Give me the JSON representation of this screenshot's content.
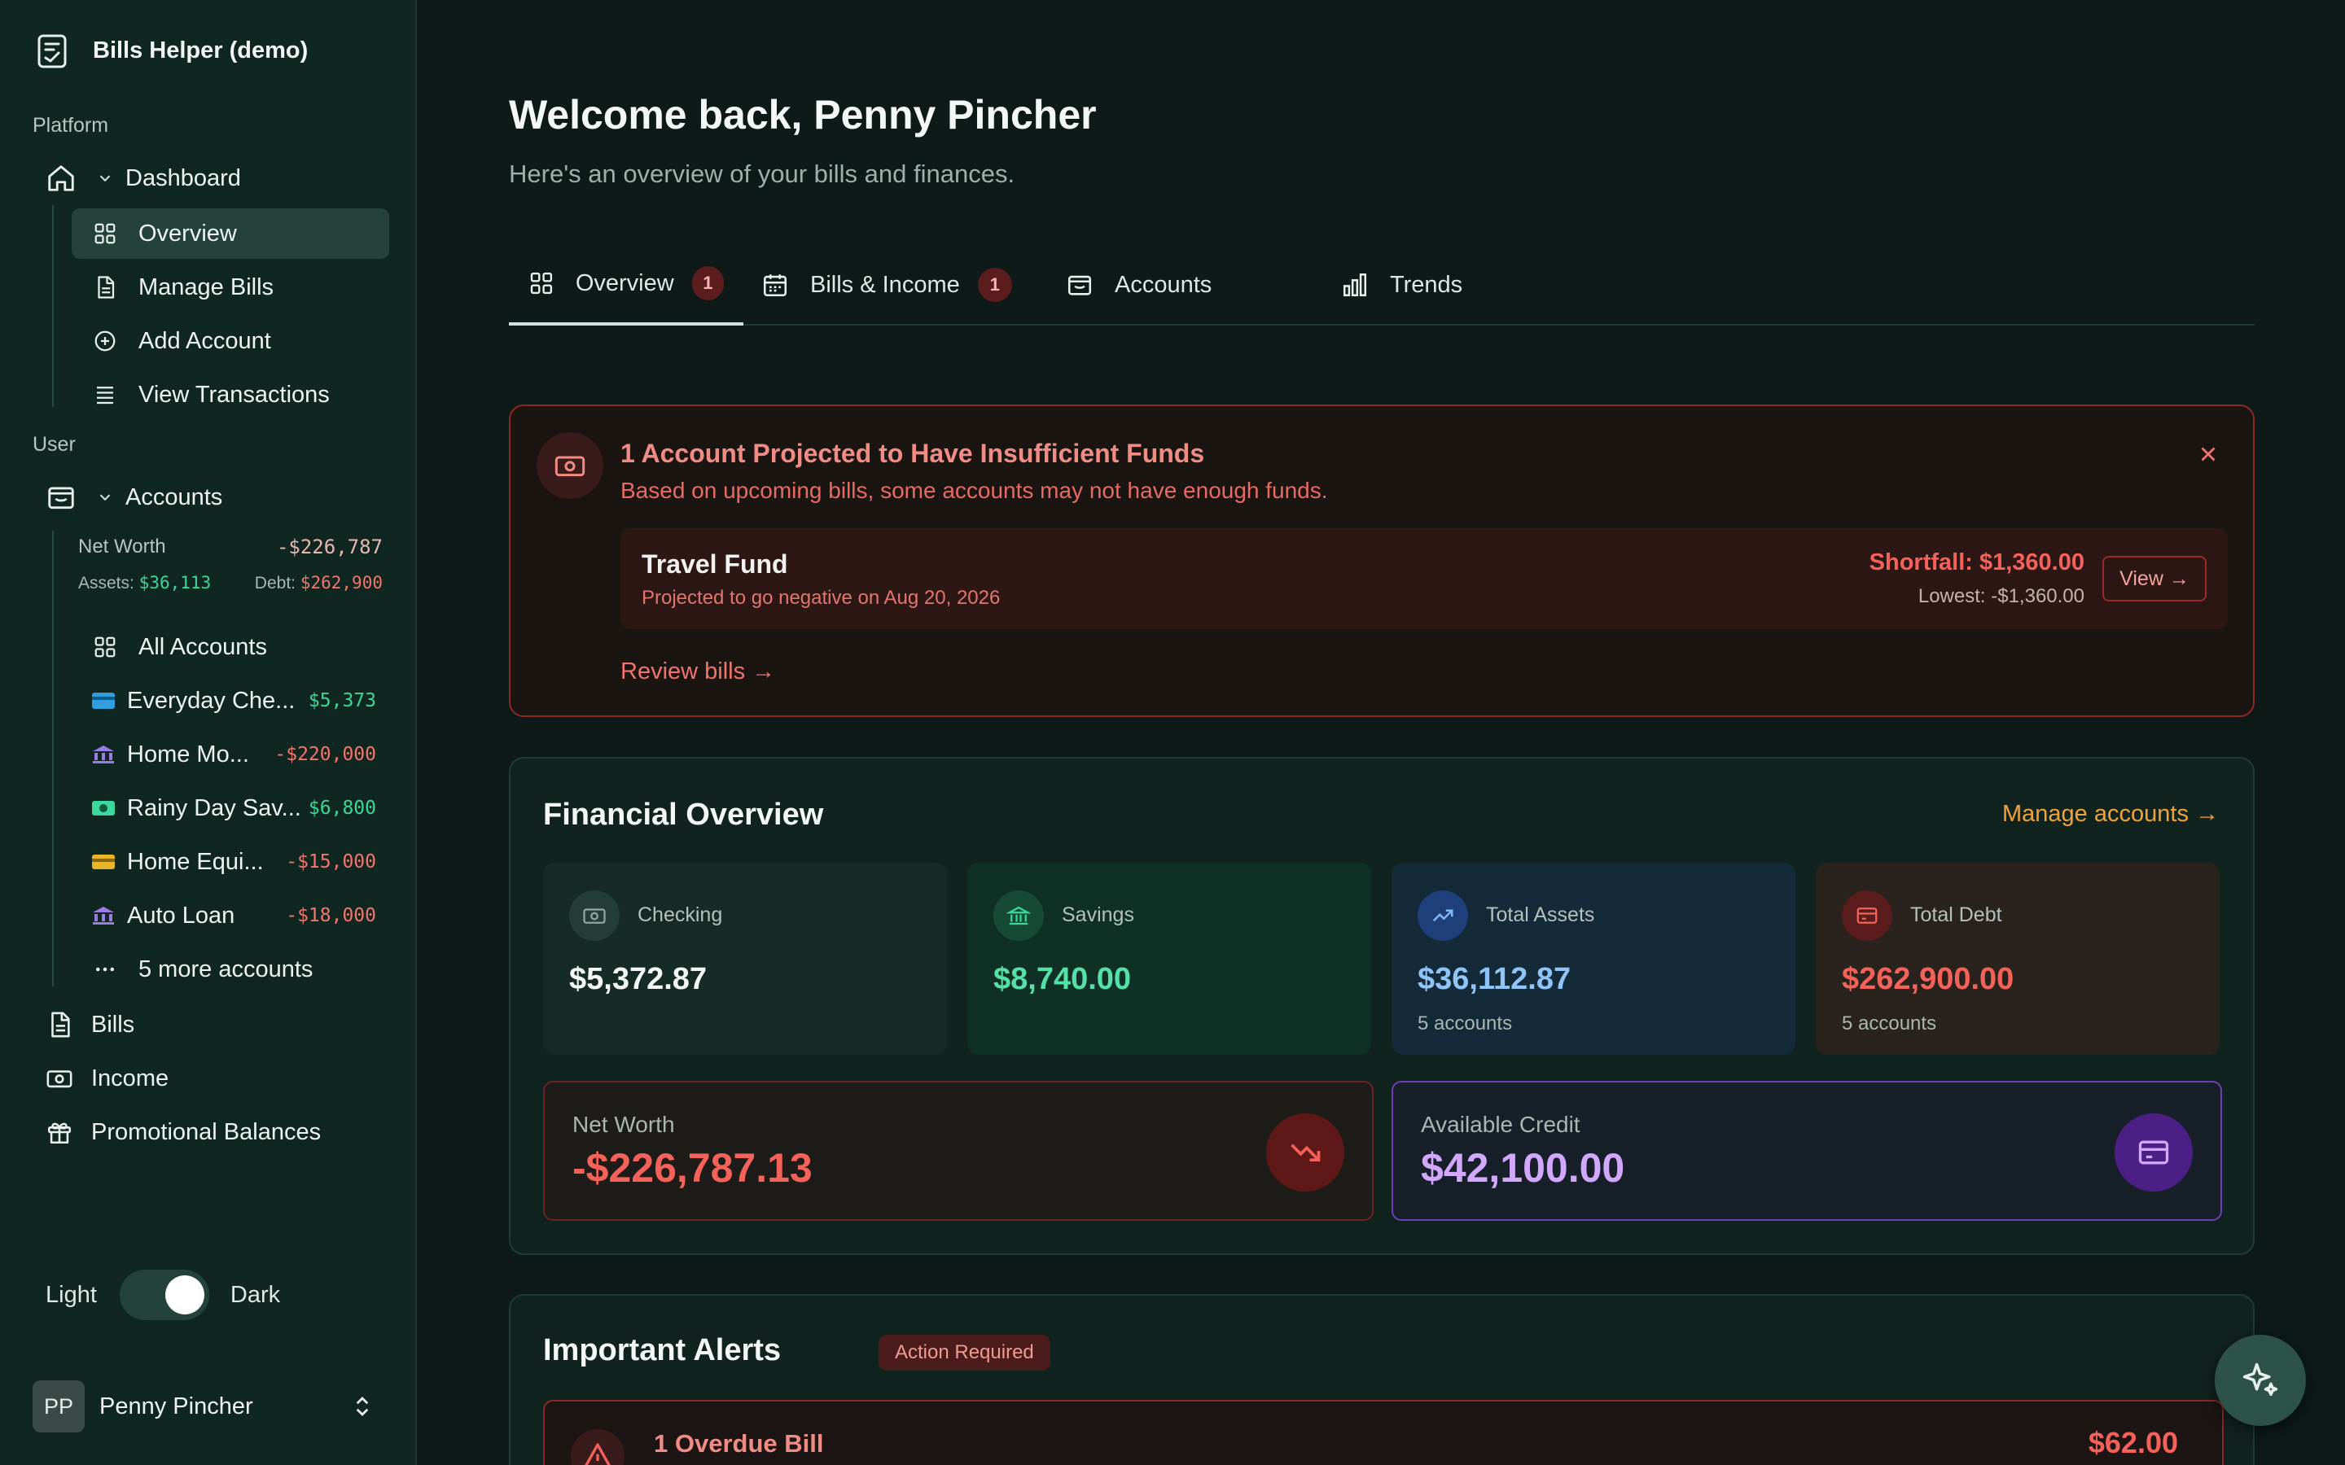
{
  "app": {
    "title": "Bills Helper (demo)"
  },
  "sidebar": {
    "platform_label": "Platform",
    "dashboard_label": "Dashboard",
    "dashboard_items": [
      {
        "label": "Overview",
        "icon": "grid-icon",
        "active": true
      },
      {
        "label": "Manage Bills",
        "icon": "document-icon"
      },
      {
        "label": "Add Account",
        "icon": "plus-circle-icon"
      },
      {
        "label": "View Transactions",
        "icon": "list-icon"
      }
    ],
    "user_label": "User",
    "accounts_label": "Accounts",
    "net_worth": {
      "label": "Net Worth",
      "value": "-$226,787",
      "assets_label": "Assets:",
      "assets_value": "$36,113",
      "debt_label": "Debt:",
      "debt_value": "$262,900"
    },
    "all_accounts_label": "All Accounts",
    "accounts": [
      {
        "name": "Everyday Che...",
        "amount": "$5,373",
        "icon": "checking-card-icon",
        "color": "#2f9fe0"
      },
      {
        "name": "Home Mo...",
        "amount": "-$220,000",
        "icon": "bank-icon",
        "color": "#9b7be6"
      },
      {
        "name": "Rainy Day Sav...",
        "amount": "$6,800",
        "icon": "cash-icon",
        "color": "#3ed79b"
      },
      {
        "name": "Home Equi...",
        "amount": "-$15,000",
        "icon": "credit-card-icon",
        "color": "#e8b527"
      },
      {
        "name": "Auto Loan",
        "amount": "-$18,000",
        "icon": "bank-icon",
        "color": "#9b7be6"
      }
    ],
    "more_accounts": "5 more accounts",
    "bills_label": "Bills",
    "income_label": "Income",
    "promo_label": "Promotional Balances",
    "theme": {
      "light": "Light",
      "dark": "Dark",
      "dark_enabled": true
    },
    "user": {
      "initials": "PP",
      "name": "Penny Pincher"
    }
  },
  "header": {
    "title": "Welcome back, Penny Pincher",
    "subtitle": "Here's an overview of your bills and finances."
  },
  "tabs": [
    {
      "label": "Overview",
      "badge": "1",
      "icon": "grid-icon",
      "active": true
    },
    {
      "label": "Bills & Income",
      "badge": "1",
      "icon": "calendar-icon"
    },
    {
      "label": "Accounts",
      "badge": "",
      "icon": "wallet-icon"
    },
    {
      "label": "Trends",
      "badge": "",
      "icon": "bar-chart-icon"
    }
  ],
  "insufficient_alert": {
    "title": "1 Account Projected to Have Insufficient Funds",
    "description": "Based on upcoming bills, some accounts may not have enough funds.",
    "account": {
      "name": "Travel Fund",
      "projection": "Projected to go negative on Aug 20, 2026",
      "shortfall": "Shortfall: $1,360.00",
      "lowest": "Lowest: -$1,360.00",
      "view_label": "View →"
    },
    "review_link": "Review bills →"
  },
  "financial_overview": {
    "title": "Financial Overview",
    "manage_link": "Manage accounts →",
    "stats": [
      {
        "label": "Checking",
        "value": "$5,372.87",
        "sub": "",
        "icon": "cash-icon"
      },
      {
        "label": "Savings",
        "value": "$8,740.00",
        "sub": "",
        "icon": "bank-icon"
      },
      {
        "label": "Total Assets",
        "value": "$36,112.87",
        "sub": "5 accounts",
        "icon": "trending-up-icon"
      },
      {
        "label": "Total Debt",
        "value": "$262,900.00",
        "sub": "5 accounts",
        "icon": "credit-card-icon"
      }
    ],
    "net_worth": {
      "label": "Net Worth",
      "value": "-$226,787.13",
      "icon": "trending-down-icon"
    },
    "available_credit": {
      "label": "Available Credit",
      "value": "$42,100.00",
      "icon": "credit-card-icon"
    }
  },
  "important_alerts": {
    "title": "Important Alerts",
    "badge": "Action Required",
    "overdue": {
      "title": "1 Overdue Bill",
      "amount": "$62.00",
      "icon": "warning-icon"
    }
  },
  "colors": {
    "background": "#0d1a17",
    "sidebar": "#102620",
    "danger": "#f4625a",
    "success": "#3ed79b",
    "accent_orange": "#f0a33b",
    "assets_blue": "#7fb8f5",
    "credit_purple": "#d2a8ff"
  }
}
